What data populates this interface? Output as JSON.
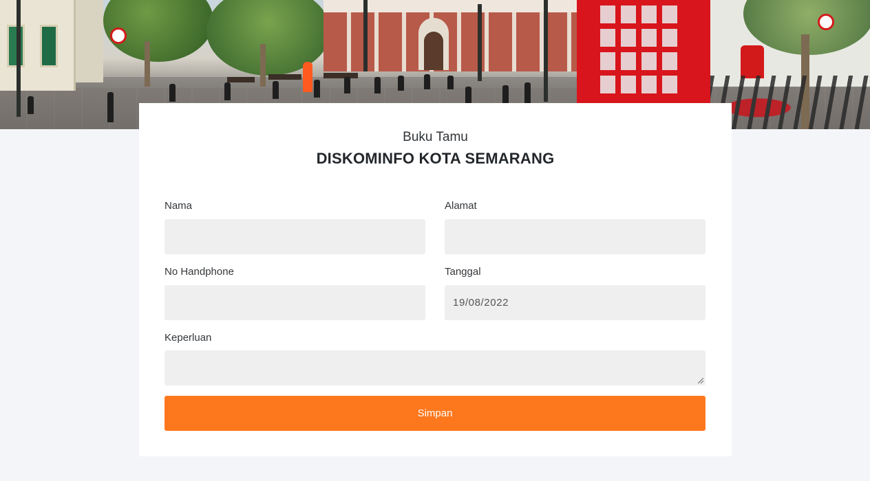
{
  "header": {
    "subtitle": "Buku Tamu",
    "title": "DISKOMINFO KOTA SEMARANG"
  },
  "form": {
    "nama": {
      "label": "Nama",
      "value": ""
    },
    "alamat": {
      "label": "Alamat",
      "value": ""
    },
    "no_handphone": {
      "label": "No Handphone",
      "value": ""
    },
    "tanggal": {
      "label": "Tanggal",
      "value": "19/08/2022"
    },
    "keperluan": {
      "label": "Keperluan",
      "value": ""
    },
    "submit_label": "Simpan"
  },
  "colors": {
    "accent": "#fd781d",
    "page_background": "#f4f5f9",
    "field_background": "#efefef",
    "card_background": "#ffffff"
  },
  "icons": {
    "textarea_resize": "resize-grip-icon"
  }
}
